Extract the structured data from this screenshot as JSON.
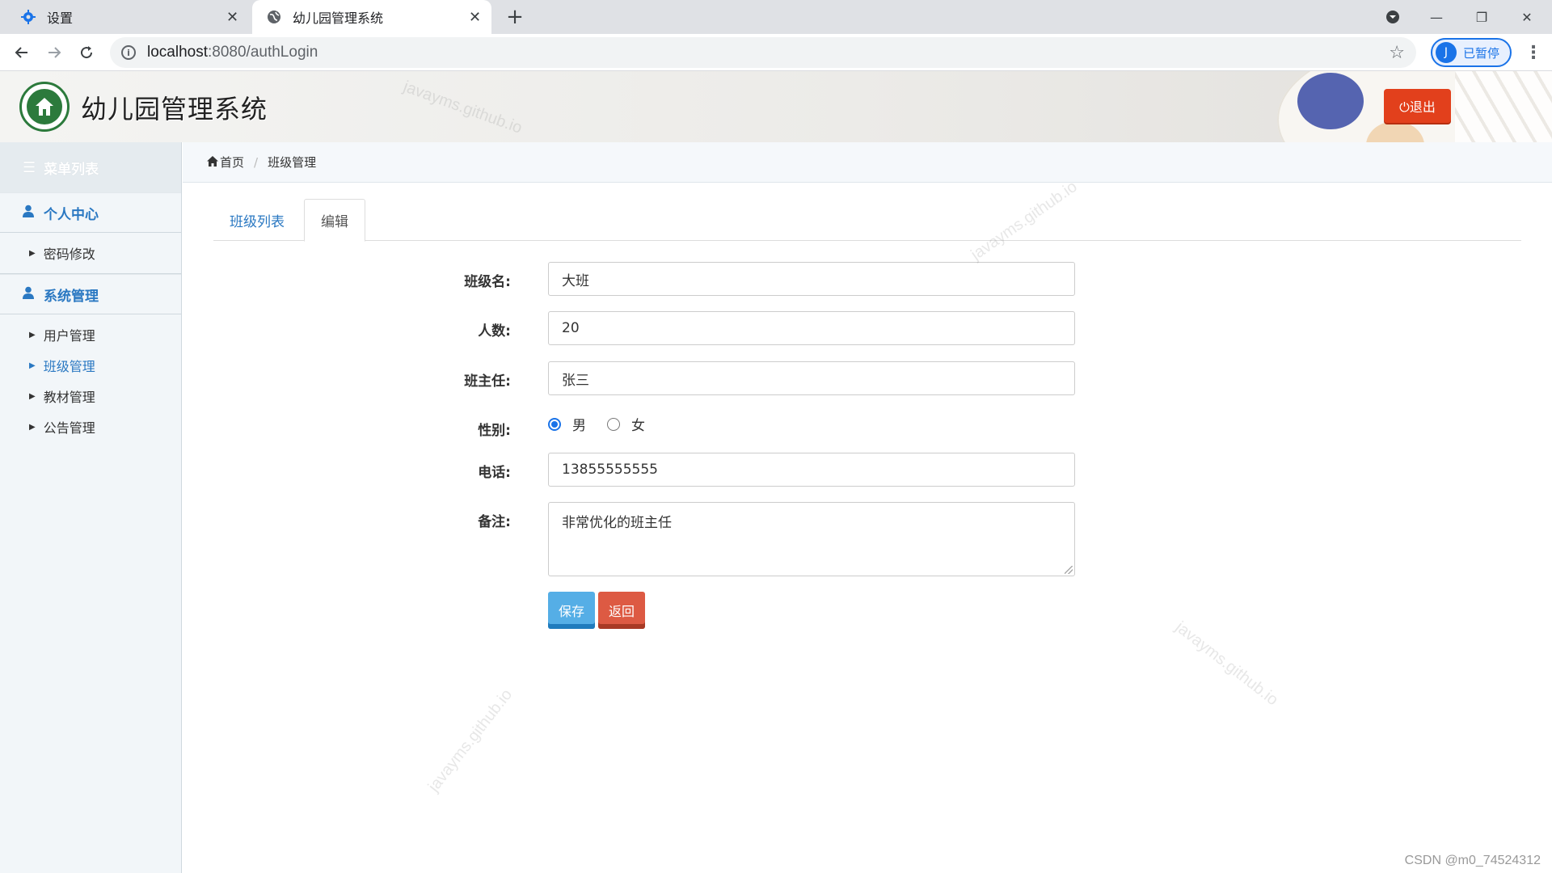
{
  "browser": {
    "tabs": [
      {
        "title": "设置"
      },
      {
        "title": "幼儿园管理系统"
      }
    ],
    "url_host": "localhost",
    "url_path": ":8080/authLogin",
    "profile_avatar": "J",
    "profile_label": "已暂停"
  },
  "header": {
    "app_title": "幼儿园管理系统",
    "logout_label": "⏻退出"
  },
  "sidebar": {
    "menu_title": "菜单列表",
    "groups": [
      {
        "title": "个人中心",
        "items": [
          {
            "label": "密码修改"
          }
        ]
      },
      {
        "title": "系统管理",
        "items": [
          {
            "label": "用户管理"
          },
          {
            "label": "班级管理"
          },
          {
            "label": "教材管理"
          },
          {
            "label": "公告管理"
          }
        ]
      }
    ],
    "active_item": "班级管理"
  },
  "breadcrumb": {
    "home": "首页",
    "current": "班级管理"
  },
  "tabs": {
    "list": "班级列表",
    "edit": "编辑"
  },
  "form": {
    "class_name": {
      "label": "班级名:",
      "value": "大班"
    },
    "count": {
      "label": "人数:",
      "value": "20"
    },
    "teacher": {
      "label": "班主任:",
      "value": "张三"
    },
    "gender": {
      "label": "性别:",
      "options": [
        "男",
        "女"
      ],
      "selected": "男"
    },
    "phone": {
      "label": "电话:",
      "value": "13855555555"
    },
    "remark": {
      "label": "备注:",
      "value": "非常优化的班主任"
    },
    "save_label": "保存",
    "back_label": "返回"
  },
  "watermark_text": "javayms.github.io",
  "footer_credit": "CSDN @m0_74524312",
  "colors": {
    "accent_blue": "#2a78c2",
    "logout_red": "#e2401c",
    "save_blue": "#55aee6",
    "back_red": "#dd5a43"
  }
}
